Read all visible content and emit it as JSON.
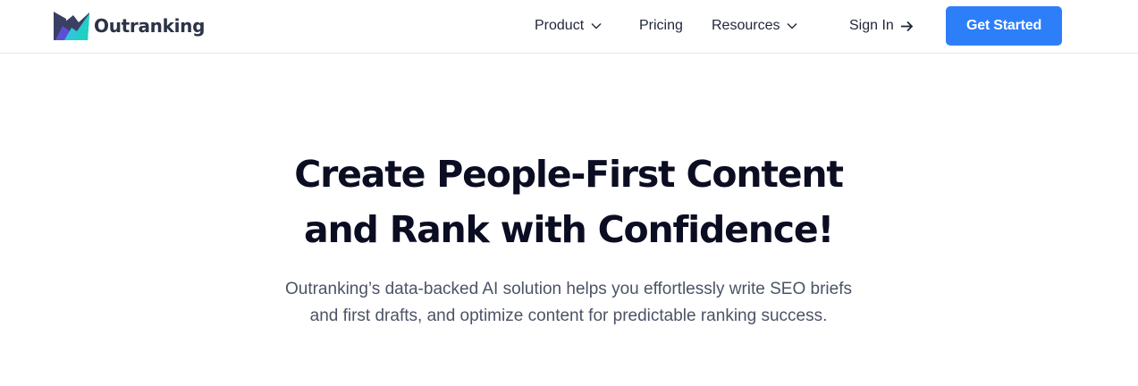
{
  "brand": {
    "name": "Outranking",
    "logo_colors": [
      "#3b3f63",
      "#5a4fd6",
      "#2fc6d8",
      "#20d0c0"
    ]
  },
  "nav": {
    "product": "Product",
    "pricing": "Pricing",
    "resources": "Resources",
    "sign_in": "Sign In",
    "get_started": "Get Started"
  },
  "icons": {
    "product_dropdown": "chevron-down-icon",
    "resources_dropdown": "chevron-down-icon",
    "sign_in": "arrow-right-icon"
  },
  "hero": {
    "title_line1": "Create People-First Content",
    "title_line2": "and Rank with Confidence!",
    "subtitle": "Outranking’s data-backed AI solution helps you effortlessly write SEO briefs and first drafts, and optimize content for predictable ranking success."
  },
  "colors": {
    "accent": "#2d7ff9",
    "heading": "#0b0d22",
    "body_text": "#4c5366",
    "border": "#e6e7ec"
  }
}
